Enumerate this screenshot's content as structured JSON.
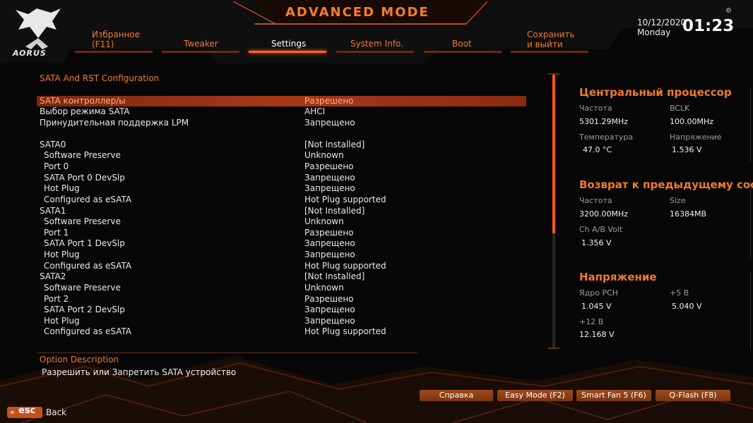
{
  "header": {
    "brand": "AORUS",
    "title": "ADVANCED MODE",
    "date": "10/12/2020",
    "day": "Monday",
    "time": "01:23",
    "accent": "#ff6a20"
  },
  "tabs": [
    {
      "label": "Избранное\n(F11)",
      "active": false
    },
    {
      "label": "Tweaker",
      "active": false
    },
    {
      "label": "Settings",
      "active": true
    },
    {
      "label": "System Info.",
      "active": false
    },
    {
      "label": "Boot",
      "active": false
    },
    {
      "label": "Сохранить\nи выйти",
      "active": false
    }
  ],
  "section_title": "SATA And RST Configuration",
  "rows": [
    {
      "label": "SATA контроллер/ы",
      "value": "Разрешено",
      "sub": false,
      "selected": true
    },
    {
      "label": "Выбор режима SATA",
      "value": "AHCI",
      "sub": false
    },
    {
      "label": "Принудительная поддержка LPM",
      "value": "Запрещено",
      "sub": false
    },
    {
      "label": "SATA0",
      "value": "[Not Installed]",
      "sub": false
    },
    {
      "label": "Software Preserve",
      "value": "Unknown",
      "sub": true
    },
    {
      "label": "Port 0",
      "value": "Разрешено",
      "sub": true
    },
    {
      "label": "SATA Port 0 DevSlp",
      "value": "Запрещено",
      "sub": true
    },
    {
      "label": "Hot Plug",
      "value": "Запрещено",
      "sub": true
    },
    {
      "label": "Configured as eSATA",
      "value": "Hot Plug supported",
      "sub": true
    },
    {
      "label": "SATA1",
      "value": "[Not Installed]",
      "sub": false
    },
    {
      "label": "Software Preserve",
      "value": "Unknown",
      "sub": true
    },
    {
      "label": "Port 1",
      "value": "Разрешено",
      "sub": true
    },
    {
      "label": "SATA Port 1 DevSlp",
      "value": "Запрещено",
      "sub": true
    },
    {
      "label": "Hot Plug",
      "value": "Запрещено",
      "sub": true
    },
    {
      "label": "Configured as eSATA",
      "value": "Hot Plug supported",
      "sub": true
    },
    {
      "label": "SATA2",
      "value": "[Not Installed]",
      "sub": false
    },
    {
      "label": "Software Preserve",
      "value": "Unknown",
      "sub": true
    },
    {
      "label": "Port 2",
      "value": "Разрешено",
      "sub": true
    },
    {
      "label": "SATA Port 2 DevSlp",
      "value": "Запрещено",
      "sub": true
    },
    {
      "label": "Hot Plug",
      "value": "Запрещено",
      "sub": true
    },
    {
      "label": "Configured as eSATA",
      "value": "Hot Plug supported",
      "sub": true
    }
  ],
  "cpu": {
    "title": "Центральный процессор",
    "freq_label": "Частота",
    "freq": "5301.29MHz",
    "bclk_label": "BCLK",
    "bclk": "100.00MHz",
    "temp_label": "Температура",
    "temp": "47.0 °C",
    "volt_label": "Напряжение",
    "volt": "1.536 V"
  },
  "memory": {
    "title": "Возврат к предыдущему состо",
    "freq_label": "Частота",
    "freq": "3200.00MHz",
    "size_label": "Size",
    "size": "16384MB",
    "volt_label": "Ch A/B Volt",
    "volt": "1.356 V"
  },
  "voltage": {
    "title": "Напряжение",
    "pch_label": "Ядро PCH",
    "pch": "1.045 V",
    "v5_label": "+5 В",
    "v5": "5.040 V",
    "v12_label": "+12 В",
    "v12": "12.168 V"
  },
  "description": {
    "title": "Option Description",
    "text": "Разрешить или Запретить SATA устройство"
  },
  "footer": {
    "help": "Справка",
    "easy_mode": "Easy Mode (F2)",
    "smart_fan": "Smart Fan 5 (F6)",
    "qflash": "Q-Flash (F8)",
    "esc": "esc",
    "back": "Back"
  }
}
